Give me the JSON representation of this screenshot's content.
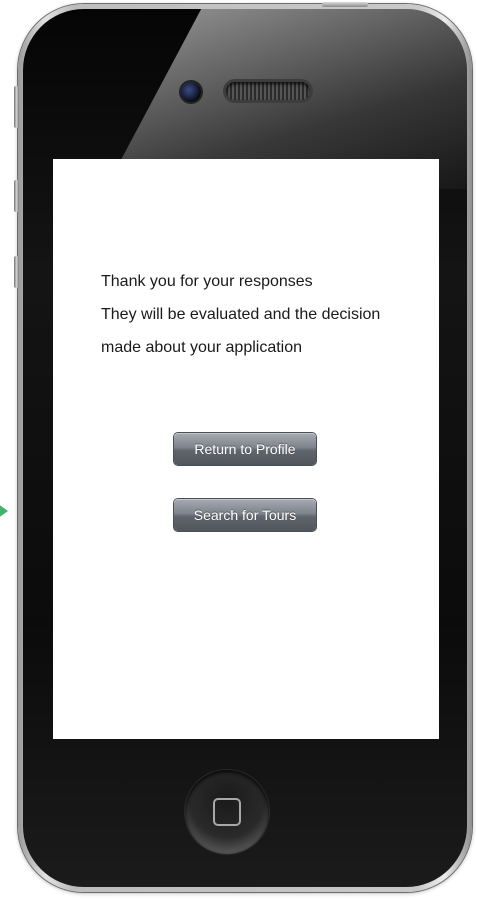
{
  "screen": {
    "message_lines": [
      "Thank you for your responses",
      "They will be evaluated and the decision",
      "made about your application"
    ],
    "buttons": {
      "return_to_profile": "Return to Profile",
      "search_for_tours": "Search for Tours"
    }
  },
  "icons": {
    "side_arrow": "green-arrow-right-icon",
    "camera": "front-camera-icon",
    "speaker": "earpiece-speaker-icon",
    "home": "home-button-icon"
  },
  "colors": {
    "button_gradient_top": "#a6abb3",
    "button_gradient_bottom": "#51555c",
    "arrow": "#41b36b",
    "screen_background": "#ffffff",
    "bezel": "#0b0b0b"
  }
}
